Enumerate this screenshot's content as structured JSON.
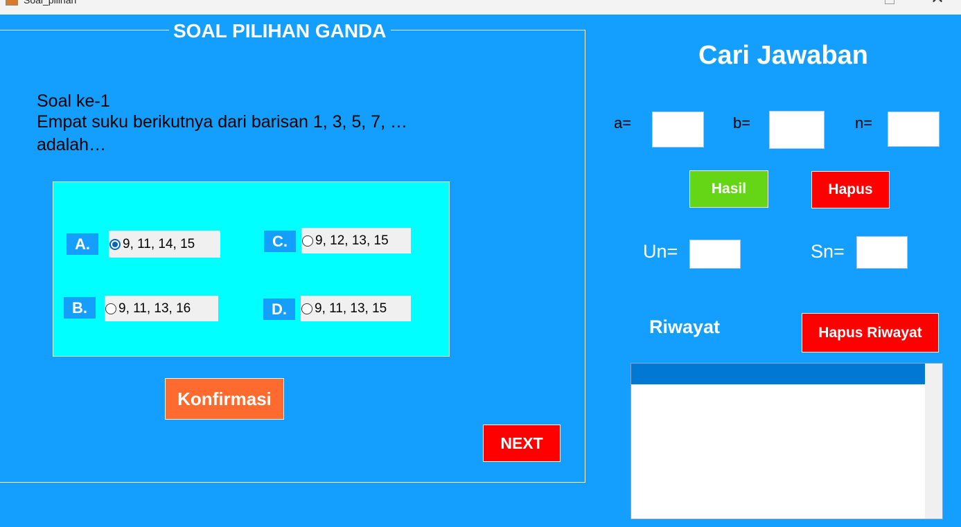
{
  "window": {
    "title": "Soal_pilihan"
  },
  "quiz": {
    "group_title": "SOAL PILIHAN GANDA",
    "question_label": "Soal ke-1",
    "question_text": " Empat suku berikutnya dari barisan 1, 3, 5, 7, …\nadalah…",
    "options": [
      {
        "letter": "A.",
        "text": "9, 11, 14, 15",
        "selected": true
      },
      {
        "letter": "B.",
        "text": "9, 11, 13, 16",
        "selected": false
      },
      {
        "letter": "C.",
        "text": "9, 12, 13, 15",
        "selected": false
      },
      {
        "letter": "D.",
        "text": "9, 11, 13, 15",
        "selected": false
      }
    ],
    "confirm_label": "Konfirmasi",
    "next_label": "NEXT"
  },
  "calculator": {
    "title": "Cari Jawaban",
    "a_label": "a=",
    "b_label": "b=",
    "n_label": "n=",
    "a_value": "",
    "b_value": "",
    "n_value": "",
    "hasil_label": "Hasil",
    "hapus_label": "Hapus",
    "un_label": "Un=",
    "sn_label": "Sn=",
    "un_value": "",
    "sn_value": "",
    "riwayat_label": "Riwayat",
    "hapus_riwayat_label": "Hapus Riwayat",
    "history_items": []
  },
  "colors": {
    "background": "#149ffe",
    "options_panel": "#00ffff",
    "confirm": "#ff6b2e",
    "danger": "#ff0000",
    "success": "#65d616"
  }
}
